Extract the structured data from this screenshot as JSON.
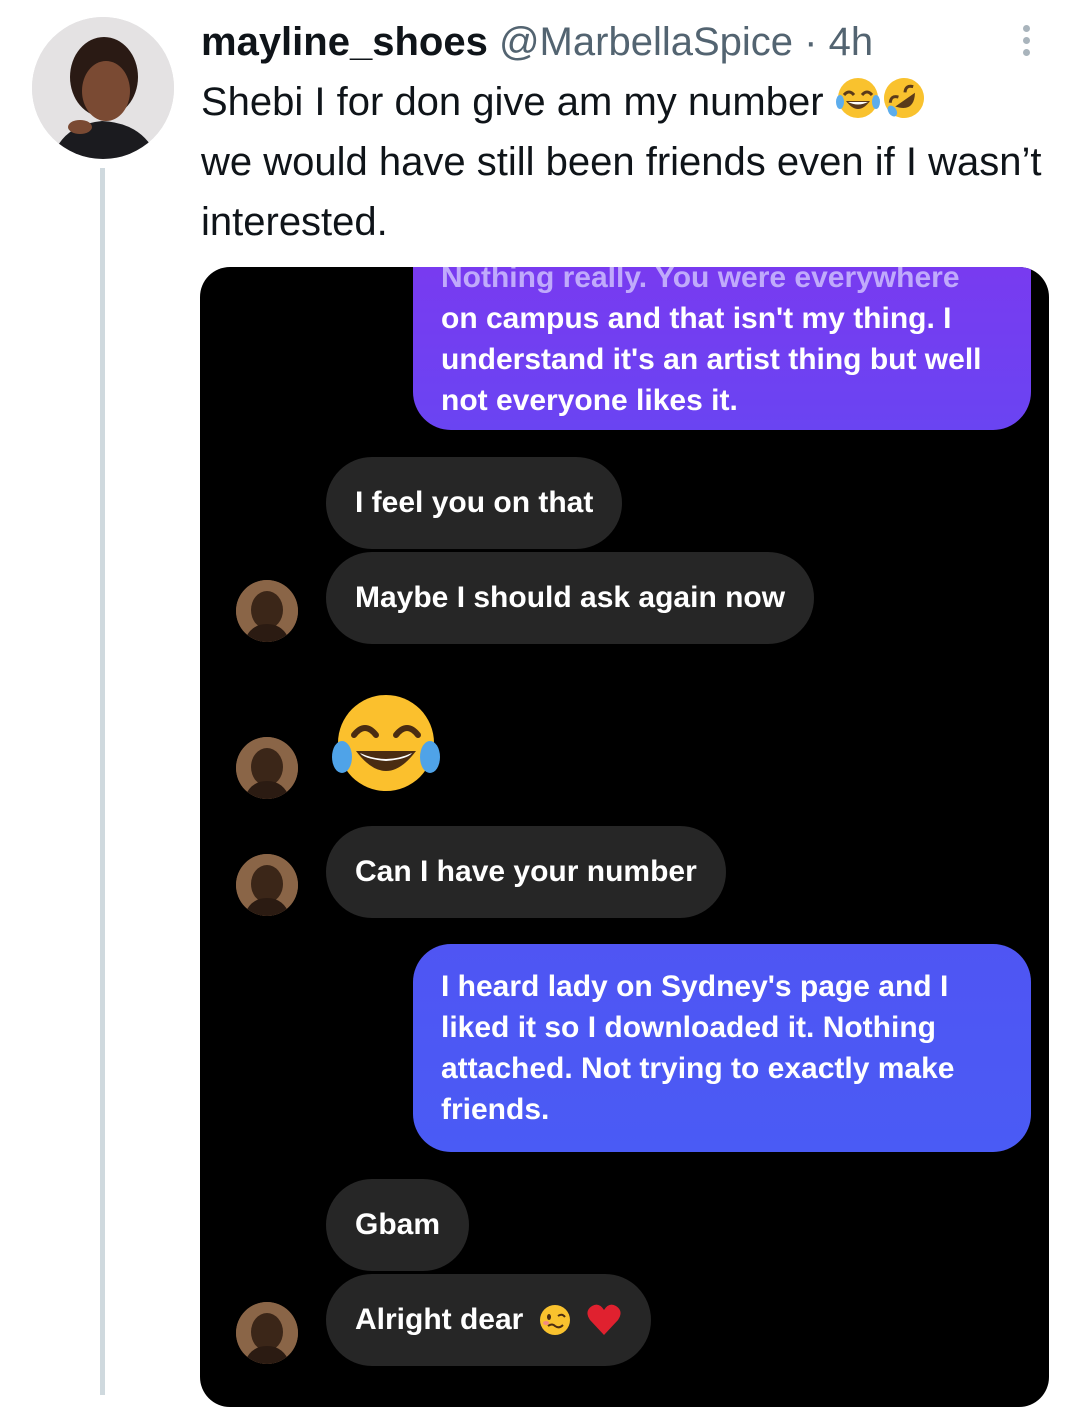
{
  "tweet": {
    "display_name": "mayline_shoes",
    "handle": "@MarbellaSpice",
    "separator": "·",
    "time": "4h",
    "text_line1": "Shebi I for don give am my number",
    "text_rest": "we would have still been friends even if I wasn’t interested.",
    "icons": [
      "more-vertical-icon",
      "joy-emoji",
      "rofl-emoji"
    ]
  },
  "chat": {
    "messages": [
      {
        "from": "me",
        "text_partial": "Nothing really. You were everywhere",
        "text": "on campus and that isn't my thing. I understand it's an artist thing but well not everyone likes it."
      },
      {
        "from": "them",
        "text": "I feel you on that"
      },
      {
        "from": "them",
        "text": "Maybe I should ask again now"
      },
      {
        "from": "them",
        "emoji": "joy-emoji"
      },
      {
        "from": "them",
        "text": "Can I have your number"
      },
      {
        "from": "me",
        "text": "I heard lady on Sydney's page and I liked it so I downloaded it. Nothing attached. Not trying to exactly make friends."
      },
      {
        "from": "them",
        "text": "Gbam"
      },
      {
        "from": "them",
        "text": "Alright dear",
        "trailing_emojis": [
          "woozy-face-emoji",
          "red-heart-emoji"
        ]
      }
    ],
    "colors": {
      "incoming_bubble": "#262626",
      "outgoing_gradient_top": "#7a3cf0",
      "outgoing_gradient_bottom": "#4c5af5",
      "background": "#000000"
    }
  }
}
